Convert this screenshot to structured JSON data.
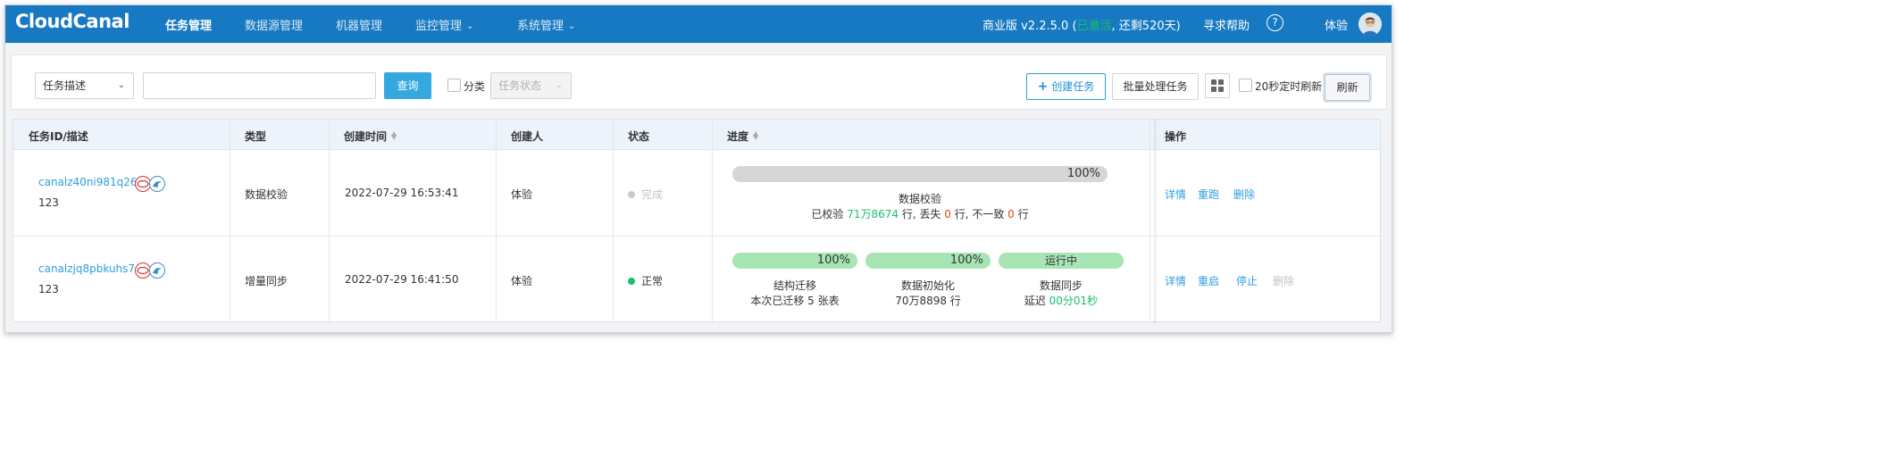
{
  "app": {
    "logo": "CloudCanal",
    "nav": [
      {
        "label": "任务管理",
        "active": true,
        "dropdown": false
      },
      {
        "label": "数据源管理",
        "active": false,
        "dropdown": false
      },
      {
        "label": "机器管理",
        "active": false,
        "dropdown": false
      },
      {
        "label": "监控管理",
        "active": false,
        "dropdown": true
      },
      {
        "label": "系统管理",
        "active": false,
        "dropdown": true
      }
    ],
    "version": "商业版 v2.2.5.0",
    "license_open": "(",
    "license_active": "已激活",
    "license_rest": ", 还剩520天)",
    "help": "寻求帮助",
    "help_icon": "?",
    "user": "体验"
  },
  "toolbar": {
    "filter_select": "任务描述",
    "search_value": "",
    "query_button": "查询",
    "group_label": "分类",
    "status_select": "任务状态",
    "create_button": "创建任务",
    "batch_button": "批量处理任务",
    "auto_refresh_label": "20秒定时刷新",
    "refresh_button": "刷新"
  },
  "table": {
    "headers": {
      "id": "任务ID/描述",
      "type": "类型",
      "created": "创建时间",
      "creator": "创建人",
      "status": "状态",
      "progress": "进度",
      "actions": "操作"
    },
    "rows": [
      {
        "id": "canalz40ni981q26",
        "desc": "123",
        "type": "数据校验",
        "created": "2022-07-29 16:53:41",
        "creator": "体验",
        "status": "完成",
        "status_color": "#c0c4cc",
        "progress": {
          "bar_value": 100,
          "bar_text": "100%",
          "title": "数据校验",
          "line_p1": "已校验 ",
          "checked": "71万8674",
          "line_p2": " 行, 丢失 ",
          "lost": "0",
          "line_p3": " 行, 不一致 ",
          "mismatch": "0",
          "line_p4": " 行"
        },
        "actions": [
          "详情",
          "重跑",
          "删除"
        ]
      },
      {
        "id": "canalzjq8pbkuhs7",
        "desc": "123",
        "type": "增量同步",
        "created": "2022-07-29 16:41:50",
        "creator": "体验",
        "status": "正常",
        "status_color": "#19be6b",
        "stages": [
          {
            "bar_value": 100,
            "bar_text": "100%",
            "title": "结构迁移",
            "sub": "本次已迁移 5 张表"
          },
          {
            "bar_value": 100,
            "bar_text": "100%",
            "title": "数据初始化",
            "sub": "70万8898 行"
          },
          {
            "bar_value": 100,
            "bar_text": "运行中",
            "title": "数据同步",
            "sub_prefix": "延迟 ",
            "sub_value": "00分01秒"
          }
        ],
        "actions": [
          "详情",
          "重启",
          "停止",
          "删除"
        ]
      }
    ]
  },
  "colors": {
    "nav_bg": "#1679c2",
    "accent": "#2d9ee0",
    "success": "#19be6b",
    "danger": "#ed4014",
    "bar_gray": "#d6d6d6",
    "bar_green": "#a8e5b4"
  }
}
